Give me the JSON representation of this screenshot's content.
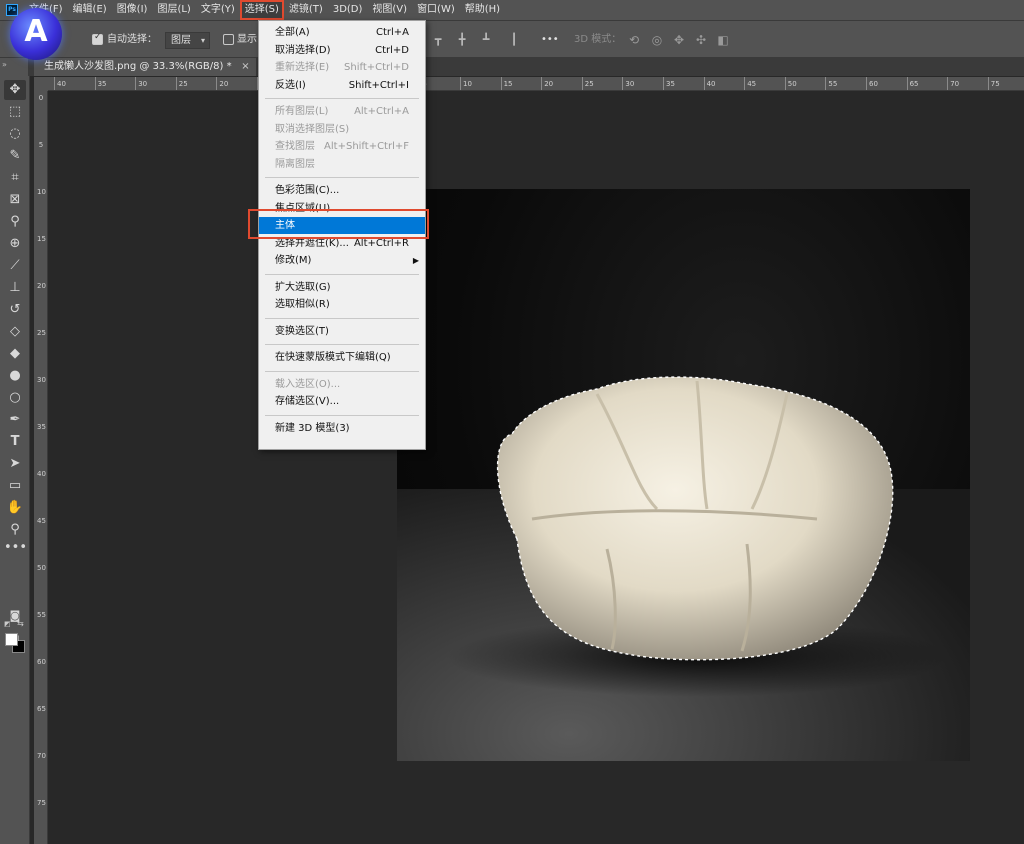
{
  "app": {
    "logo_text": "Ps",
    "brand_badge": "A"
  },
  "menubar": [
    {
      "label": "文件(F)"
    },
    {
      "label": "编辑(E)"
    },
    {
      "label": "图像(I)"
    },
    {
      "label": "图层(L)"
    },
    {
      "label": "文字(Y)"
    },
    {
      "label": "选择(S)",
      "active": true
    },
    {
      "label": "滤镜(T)"
    },
    {
      "label": "3D(D)"
    },
    {
      "label": "视图(V)"
    },
    {
      "label": "窗口(W)"
    },
    {
      "label": "帮助(H)"
    }
  ],
  "options": {
    "auto_select_label": "自动选择：",
    "auto_select_checked": true,
    "layer_dropdown_value": "图层",
    "show_label": "显示",
    "more_label": "•••",
    "mode_3d_label": "3D 模式："
  },
  "document": {
    "tab_title": "生成懒人沙发图.png @ 33.3%(RGB/8) *",
    "close_glyph": "×"
  },
  "ruler": {
    "top_labels": [
      "40",
      "35",
      "30",
      "25",
      "20",
      "15",
      "10",
      "5",
      "0",
      "5",
      "10",
      "15",
      "20",
      "25",
      "30",
      "35",
      "40",
      "45",
      "50",
      "55",
      "60",
      "65",
      "70",
      "75"
    ],
    "left_labels": [
      "0",
      "5",
      "10",
      "15",
      "20",
      "25",
      "30",
      "35",
      "40",
      "45",
      "50",
      "55",
      "60",
      "65",
      "70",
      "75"
    ]
  },
  "select_menu": {
    "items": [
      {
        "label": "全部(A)",
        "shortcut": "Ctrl+A",
        "disabled": false
      },
      {
        "label": "取消选择(D)",
        "shortcut": "Ctrl+D",
        "disabled": false
      },
      {
        "label": "重新选择(E)",
        "shortcut": "Shift+Ctrl+D",
        "disabled": true
      },
      {
        "label": "反选(I)",
        "shortcut": "Shift+Ctrl+I",
        "disabled": false
      },
      {
        "separator": true
      },
      {
        "label": "所有图层(L)",
        "shortcut": "Alt+Ctrl+A",
        "disabled": true
      },
      {
        "label": "取消选择图层(S)",
        "shortcut": "",
        "disabled": true
      },
      {
        "label": "查找图层",
        "shortcut": "Alt+Shift+Ctrl+F",
        "disabled": true
      },
      {
        "label": "隔离图层",
        "shortcut": "",
        "disabled": true
      },
      {
        "separator": true
      },
      {
        "label": "色彩范围(C)...",
        "shortcut": "",
        "disabled": false
      },
      {
        "label": "焦点区域(U)...",
        "shortcut": "",
        "disabled": false
      },
      {
        "label": "主体",
        "shortcut": "",
        "disabled": false,
        "highlighted": true
      },
      {
        "label": "选择并遮住(K)...",
        "shortcut": "Alt+Ctrl+R",
        "disabled": false
      },
      {
        "label": "修改(M)",
        "shortcut": "",
        "disabled": false,
        "submenu": true
      },
      {
        "separator": true
      },
      {
        "label": "扩大选取(G)",
        "shortcut": "",
        "disabled": false
      },
      {
        "label": "选取相似(R)",
        "shortcut": "",
        "disabled": false
      },
      {
        "separator": true
      },
      {
        "label": "变换选区(T)",
        "shortcut": "",
        "disabled": false
      },
      {
        "separator": true
      },
      {
        "label": "在快速蒙版模式下编辑(Q)",
        "shortcut": "",
        "disabled": false
      },
      {
        "separator": true
      },
      {
        "label": "载入选区(O)...",
        "shortcut": "",
        "disabled": true
      },
      {
        "label": "存储选区(V)...",
        "shortcut": "",
        "disabled": false
      },
      {
        "separator": true
      },
      {
        "label": "新建 3D 模型(3)",
        "shortcut": "",
        "disabled": false
      }
    ],
    "submenu_arrow": "▶"
  },
  "colors": {
    "highlight": "#0078d7",
    "annotation_border": "#e04a2f",
    "foreground": "#ffffff",
    "background": "#000000"
  }
}
